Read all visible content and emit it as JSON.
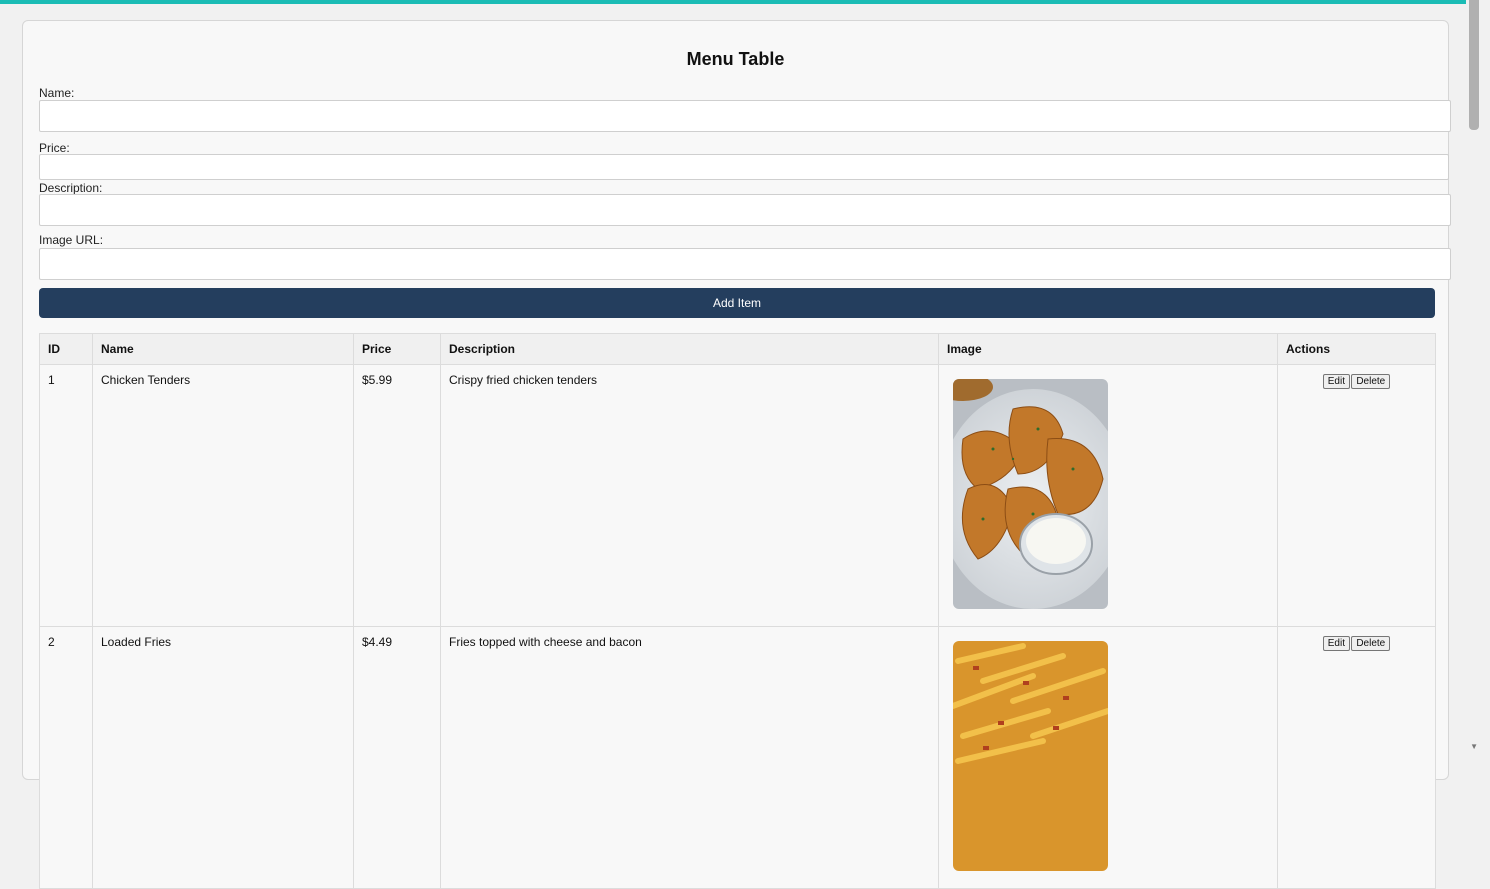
{
  "page": {
    "title": "Menu Table",
    "colors": {
      "accent_top": "#1bbcb5",
      "button_bg": "#243e5e"
    }
  },
  "form": {
    "name_label": "Name:",
    "name_value": "",
    "price_label": "Price:",
    "price_value": "",
    "description_label": "Description:",
    "description_value": "",
    "image_url_label": "Image URL:",
    "image_url_value": "",
    "submit_label": "Add Item"
  },
  "table": {
    "headers": [
      "ID",
      "Name",
      "Price",
      "Description",
      "Image",
      "Actions"
    ],
    "rows": [
      {
        "id": "1",
        "name": "Chicken Tenders",
        "price": "$5.99",
        "description": "Crispy fried chicken tenders",
        "image": "chicken-tenders-photo",
        "edit_label": "Edit",
        "delete_label": "Delete"
      },
      {
        "id": "2",
        "name": "Loaded Fries",
        "price": "$4.49",
        "description": "Fries topped with cheese and bacon",
        "image": "loaded-fries-photo",
        "edit_label": "Edit",
        "delete_label": "Delete"
      }
    ]
  }
}
